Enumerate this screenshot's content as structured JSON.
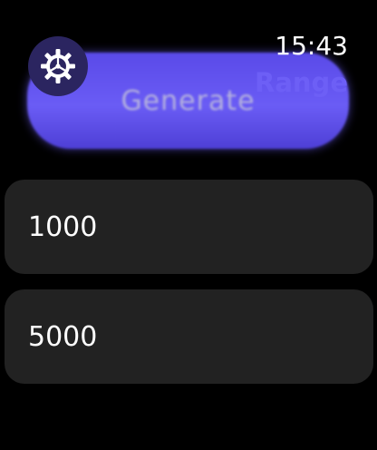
{
  "status": {
    "time": "15:43"
  },
  "header": {
    "title": "Range",
    "settings_icon": "gear-icon"
  },
  "action": {
    "generate_label": "Generate"
  },
  "ranges": [
    {
      "value": "1000"
    },
    {
      "value": "5000"
    }
  ],
  "colors": {
    "accent": "#6a5cf5",
    "item_background": "#222222",
    "background": "#000000"
  }
}
